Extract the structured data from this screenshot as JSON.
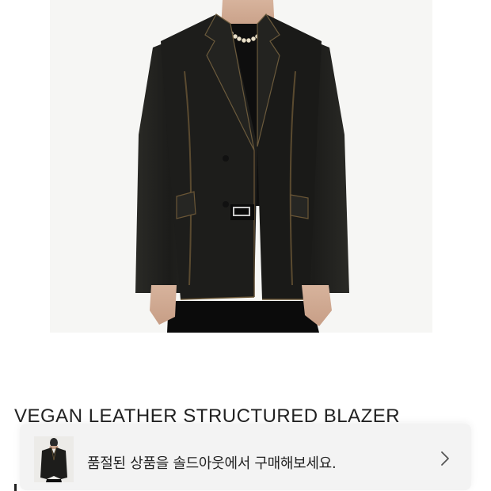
{
  "product": {
    "title": "VEGAN LEATHER STRUCTURED BLAZER",
    "image_alt": "black distressed vegan leather blazer worn by model"
  },
  "soldout_banner": {
    "message": "품절된 상품을 솔드아웃에서 구매해보세요.",
    "chevron": "chevron-right-icon"
  },
  "colors": {
    "background": "#ffffff",
    "banner_bg": "#f3f3f3",
    "text": "#222222"
  }
}
